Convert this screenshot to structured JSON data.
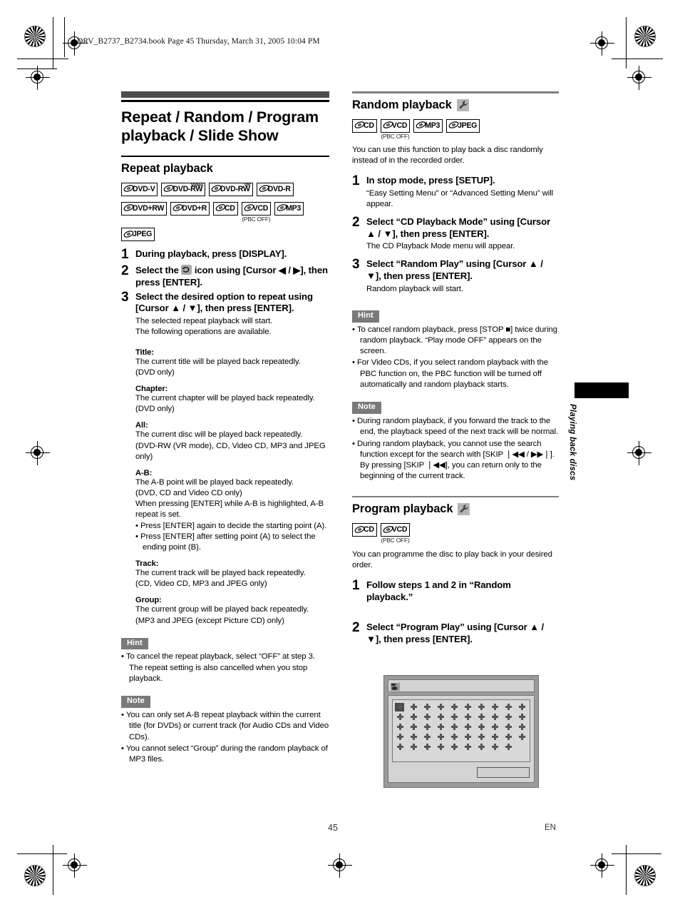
{
  "header": {
    "text": "DRV_B2737_B2734.book  Page 45  Thursday, March 31, 2005  10:04 PM"
  },
  "chapter": {
    "title": "Repeat / Random / Program playback / Slide Show"
  },
  "footer": {
    "page_number": "45",
    "language": "EN"
  },
  "side_tab": {
    "label": "Playing back discs"
  },
  "sections": {
    "repeat": {
      "title": "Repeat playback",
      "badges": [
        {
          "label": "DVD-V",
          "sup": "",
          "note": ""
        },
        {
          "label": "DVD-RW",
          "sup": "Video",
          "note": ""
        },
        {
          "label": "DVD-RW",
          "sup": "VR",
          "note": ""
        },
        {
          "label": "DVD-R",
          "sup": "",
          "note": ""
        },
        {
          "label": "DVD+RW",
          "sup": "",
          "note": ""
        },
        {
          "label": "DVD+R",
          "sup": "",
          "note": ""
        },
        {
          "label": "CD",
          "sup": "",
          "note": ""
        },
        {
          "label": "VCD",
          "sup": "",
          "note": "(PBC OFF)"
        },
        {
          "label": "MP3",
          "sup": "",
          "note": ""
        },
        {
          "label": "JPEG",
          "sup": "",
          "note": ""
        }
      ],
      "steps": [
        {
          "num": "1",
          "head_before": "During playback, press [DISPLAY].",
          "head_after": "",
          "has_icon": false,
          "sub": ""
        },
        {
          "num": "2",
          "head_before": "Select the ",
          "head_after": " icon using [Cursor ◀ / ▶], then press [ENTER].",
          "has_icon": true,
          "sub": ""
        },
        {
          "num": "3",
          "head_before": "Select the desired option to repeat using [Cursor ▲ / ▼], then press [ENTER].",
          "head_after": "",
          "has_icon": false,
          "sub": "The selected repeat playback will start.\nThe following operations are available."
        }
      ],
      "definitions": [
        {
          "term": "Title:",
          "lines": [
            "The current title will be played back repeatedly.",
            "(DVD only)"
          ],
          "bullets": []
        },
        {
          "term": "Chapter:",
          "lines": [
            "The current chapter will be played back repeatedly.",
            "(DVD only)"
          ],
          "bullets": []
        },
        {
          "term": "All:",
          "lines": [
            "The current disc will be played back repeatedly.",
            "(DVD-RW (VR mode), CD, Video CD, MP3 and JPEG only)"
          ],
          "bullets": []
        },
        {
          "term": "A-B:",
          "lines": [
            "The A-B point will be played back repeatedly.",
            "(DVD, CD and Video CD only)",
            "When pressing [ENTER] while A-B is highlighted, A-B repeat is set."
          ],
          "bullets": [
            "Press [ENTER] again to decide the starting point (A).",
            "Press [ENTER] after setting point (A) to select the ending point (B)."
          ]
        },
        {
          "term": "Track:",
          "lines": [
            "The current track will be played back repeatedly.",
            "(CD, Video CD, MP3 and JPEG only)"
          ],
          "bullets": []
        },
        {
          "term": "Group:",
          "lines": [
            "The current group will be played back repeatedly.",
            "(MP3 and JPEG (except Picture CD) only)"
          ],
          "bullets": []
        }
      ],
      "hint": {
        "tag": "Hint",
        "items": [
          "To cancel the repeat playback, select “OFF” at step 3. The repeat setting is also cancelled when you stop playback."
        ]
      },
      "note": {
        "tag": "Note",
        "items": [
          "You can only set A-B repeat playback within the current title (for DVDs) or current track (for Audio CDs and Video CDs).",
          "You cannot select “Group” during the random playback of MP3 files."
        ]
      }
    },
    "random": {
      "title": "Random playback",
      "badges": [
        {
          "label": "CD",
          "sup": "",
          "note": ""
        },
        {
          "label": "VCD",
          "sup": "",
          "note": "(PBC OFF)"
        },
        {
          "label": "MP3",
          "sup": "",
          "note": ""
        },
        {
          "label": "JPEG",
          "sup": "",
          "note": ""
        }
      ],
      "intro": "You can use this function to play back a disc randomly instead of in the recorded order.",
      "steps": [
        {
          "num": "1",
          "head": "In stop mode, press [SETUP].",
          "sub": "“Easy Setting Menu” or “Advanced Setting Menu” will appear."
        },
        {
          "num": "2",
          "head": "Select “CD Playback Mode” using [Cursor ▲ / ▼], then press [ENTER].",
          "sub": "The CD Playback Mode menu will appear."
        },
        {
          "num": "3",
          "head": "Select “Random Play” using [Cursor ▲ / ▼], then press [ENTER].",
          "sub": "Random playback will start."
        }
      ],
      "hint": {
        "tag": "Hint",
        "items": [
          "To cancel random playback, press [STOP ■] twice during random playback. “Play mode OFF” appears on the screen.",
          "For Video CDs, if you select random playback with the PBC function on, the PBC function will be turned off automatically and random playback starts."
        ]
      },
      "note": {
        "tag": "Note",
        "items": [
          "During random playback, if you forward the track to the end, the playback speed of the next track will be normal.",
          "During random playback, you cannot use the search function except for the search with [SKIP ❘◀◀ / ▶▶❘]. By pressing  [SKIP ❘◀◀], you can return only to the beginning of the current track."
        ]
      }
    },
    "program": {
      "title": "Program playback",
      "badges": [
        {
          "label": "CD",
          "sup": "",
          "note": ""
        },
        {
          "label": "VCD",
          "sup": "",
          "note": "(PBC OFF)"
        }
      ],
      "intro": "You can programme the disc to play back in your desired order.",
      "steps": [
        {
          "num": "1",
          "head": "Follow steps 1 and 2 in “Random playback.”",
          "sub": ""
        },
        {
          "num": "2",
          "head": "Select “Program Play” using [Cursor ▲ / ▼], then press [ENTER].",
          "sub": ""
        }
      ],
      "screen_mock": {
        "rows": 5,
        "cols": 10,
        "last_row_cols": 9
      }
    }
  },
  "icons": {
    "repeat": "repeat-icon",
    "wrench": "wrench-icon",
    "disc": "disc-glyph-icon"
  },
  "colors": {
    "rule_dark": "#4d4d4d",
    "callout_tag": "#7a7a7a",
    "mock_frame": "#9a9a9a"
  }
}
